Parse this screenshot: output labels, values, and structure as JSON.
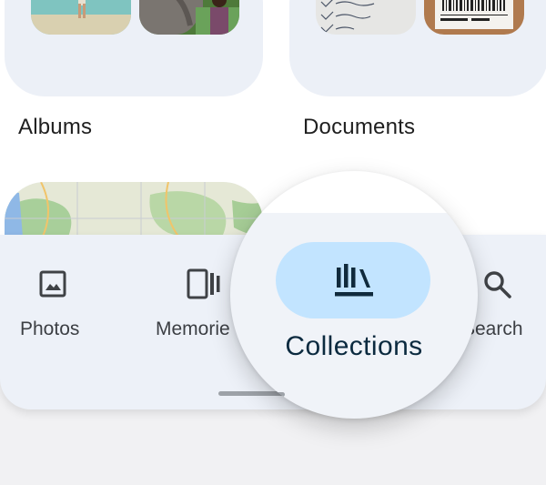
{
  "sections": {
    "albums_label": "Albums",
    "documents_label": "Documents"
  },
  "nav": {
    "items": [
      {
        "label": "Photos",
        "icon": "photo-icon",
        "selected": false
      },
      {
        "label": "Memorie",
        "icon": "memories-icon",
        "selected": false
      },
      {
        "label": "Collections",
        "icon": "collections-icon",
        "selected": true
      },
      {
        "label": "Search",
        "icon": "search-icon",
        "selected": false
      }
    ]
  },
  "colors": {
    "selected_pill": "#c2e4ff",
    "nav_background": "#edf1f8",
    "card_background": "#ecf0f7"
  }
}
